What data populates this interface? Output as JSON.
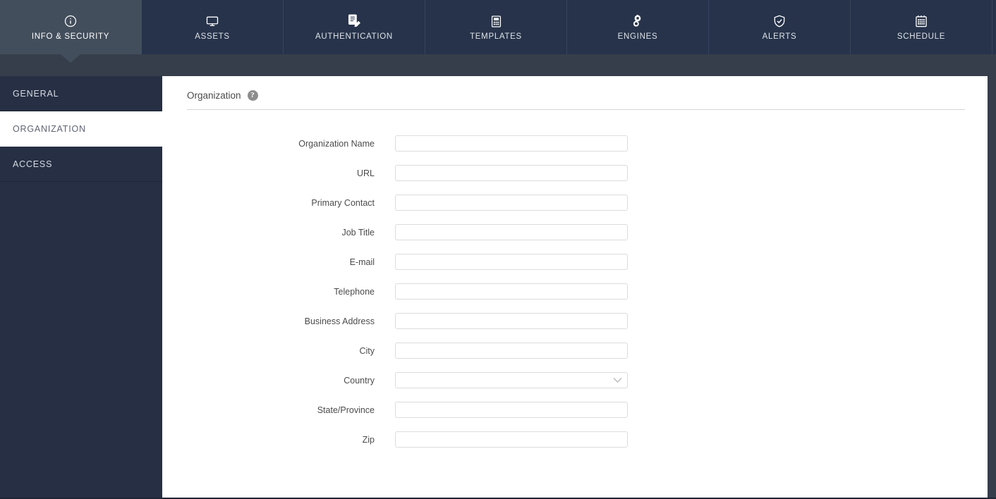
{
  "topnav": {
    "tabs": [
      {
        "label": "INFO & SECURITY",
        "icon": "info-circle-icon",
        "active": true
      },
      {
        "label": "ASSETS",
        "icon": "monitor-icon",
        "active": false
      },
      {
        "label": "AUTHENTICATION",
        "icon": "document-pen-icon",
        "active": false
      },
      {
        "label": "TEMPLATES",
        "icon": "template-form-icon",
        "active": false
      },
      {
        "label": "ENGINES",
        "icon": "gears-icon",
        "active": false
      },
      {
        "label": "ALERTS",
        "icon": "shield-check-icon",
        "active": false
      },
      {
        "label": "SCHEDULE",
        "icon": "calendar-icon",
        "active": false
      }
    ]
  },
  "sidebar": {
    "items": [
      {
        "label": "GENERAL",
        "selected": false
      },
      {
        "label": "ORGANIZATION",
        "selected": true
      },
      {
        "label": "ACCESS",
        "selected": false
      }
    ]
  },
  "main": {
    "section_title": "Organization",
    "help_glyph": "?",
    "fields": [
      {
        "label": "Organization Name",
        "type": "text",
        "value": "",
        "placeholder": ""
      },
      {
        "label": "URL",
        "type": "text",
        "value": "",
        "placeholder": ""
      },
      {
        "label": "Primary Contact",
        "type": "text",
        "value": "",
        "placeholder": ""
      },
      {
        "label": "Job Title",
        "type": "text",
        "value": "",
        "placeholder": ""
      },
      {
        "label": "E-mail",
        "type": "text",
        "value": "",
        "placeholder": ""
      },
      {
        "label": "Telephone",
        "type": "text",
        "value": "",
        "placeholder": ""
      },
      {
        "label": "Business Address",
        "type": "text",
        "value": "",
        "placeholder": ""
      },
      {
        "label": "City",
        "type": "text",
        "value": "",
        "placeholder": ""
      },
      {
        "label": "Country",
        "type": "select",
        "value": "",
        "options": [
          ""
        ]
      },
      {
        "label": "State/Province",
        "type": "text",
        "value": "",
        "placeholder": ""
      },
      {
        "label": "Zip",
        "type": "text",
        "value": "",
        "placeholder": ""
      }
    ]
  },
  "colors": {
    "tab_inactive_bg": "#26334a",
    "tab_active_bg": "#434e5c",
    "subband_bg": "#363e4b",
    "sidebar_bg": "#262f44",
    "content_bg": "#ffffff",
    "input_border": "#dcdcdc",
    "help_icon_bg": "#8d8d8d"
  }
}
